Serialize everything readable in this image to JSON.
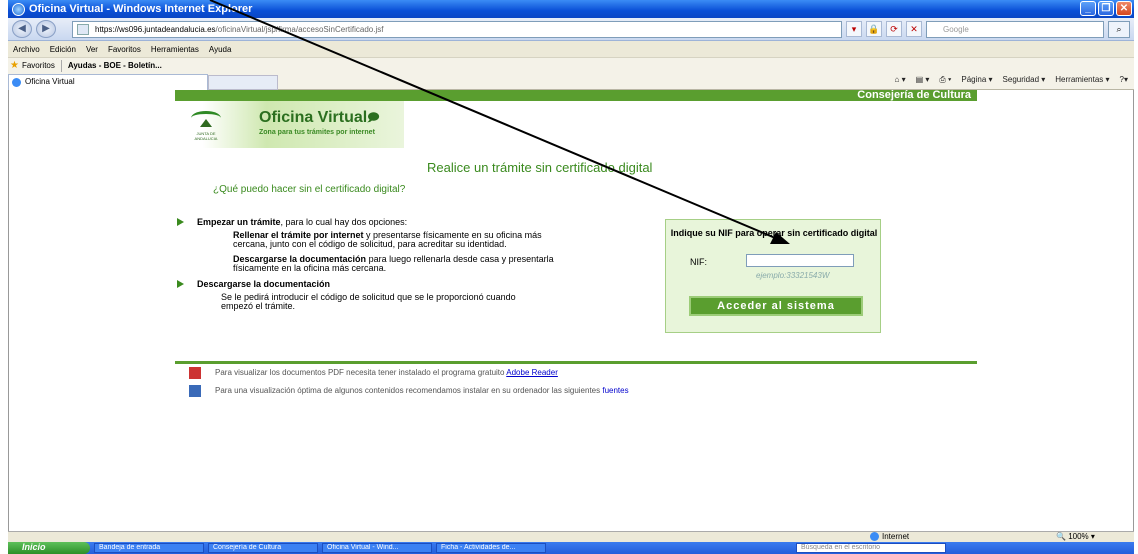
{
  "window": {
    "title": "Oficina Virtual - Windows Internet Explorer"
  },
  "address": {
    "url_prefix": "https://ws096.",
    "url_domain": "juntadeandalucia.es",
    "url_path": "/oficinaVirtual/jsp/firma/accesoSinCertificado.jsf"
  },
  "search": {
    "placeholder": "Google"
  },
  "menu": [
    "Archivo",
    "Edición",
    "Ver",
    "Favoritos",
    "Herramientas",
    "Ayuda"
  ],
  "favorites": {
    "label": "Favoritos",
    "item": "Ayudas - BOE - Boletín..."
  },
  "tab": {
    "label": "Oficina Virtual"
  },
  "commands": [
    "Página ▾",
    "Seguridad ▾",
    "Herramientas ▾"
  ],
  "page": {
    "org": "Consejería de Cultura",
    "brand_title": "Oficina Virtual",
    "brand_sub": "Zona para tus trámites por internet",
    "logo_text": "JUNTA DE ANDALUCIA",
    "heading": "Realice un trámite sin certificado digital",
    "question": "¿Qué puedo hacer sin el certificado digital?",
    "opt1_bold": "Empezar un trámite",
    "opt1_rest": ", para lo cual hay dos opciones:",
    "sub1_bold": "Rellenar el trámite por internet",
    "sub1_rest": " y presentarse físicamente en su oficina más cercana, junto con el código de solicitud, para acreditar su identidad.",
    "sub2_bold": "Descargarse la documentación",
    "sub2_rest": " para luego rellenarla desde casa y presentarla físicamente en la oficina más cercana.",
    "opt2_bold": "Descargarse la documentación",
    "opt2_desc": "Se le pedirá introducir el código de solicitud que se le proporcionó cuando empezó el trámite.",
    "nif_title": "Indique su NIF para operar sin certificado digital",
    "nif_label": "NIF:",
    "nif_example": "ejemplo:33321543W",
    "access_button": "Acceder al sistema",
    "foot1_text": "Para visualizar los documentos PDF necesita tener instalado el programa gratuito ",
    "foot1_link": "Adobe Reader",
    "foot2_text": "Para una visualización óptima de algunos contenidos recomendamos instalar en su ordenador las siguientes ",
    "foot2_link": "fuentes"
  },
  "status": {
    "zone": "Internet",
    "zoom": "100%"
  },
  "taskbar": {
    "start": "Inicio",
    "items": [
      "Bandeja de entrada",
      "Consejería de Cultura",
      "Oficina Virtual - Wind...",
      "Ficha - Actividades de..."
    ],
    "search": "Búsqueda en el escritorio"
  }
}
